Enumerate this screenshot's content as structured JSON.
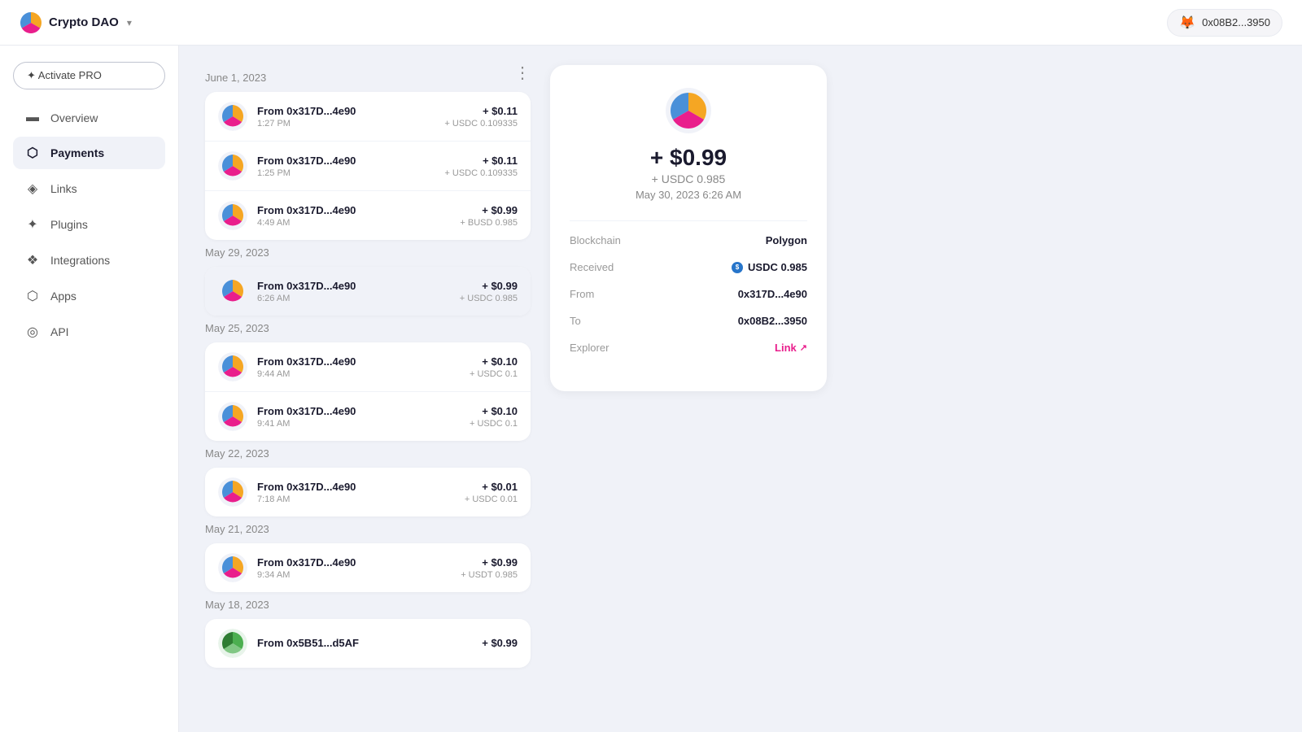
{
  "topbar": {
    "app_name": "Crypto DAO",
    "dropdown_label": "▾",
    "wallet_address": "0x08B2...3950",
    "fox_emoji": "🦊"
  },
  "sidebar": {
    "activate_btn": "✦ Activate PRO",
    "items": [
      {
        "id": "overview",
        "label": "Overview",
        "icon": "▬",
        "active": false
      },
      {
        "id": "payments",
        "label": "Payments",
        "icon": "⬡",
        "active": true
      },
      {
        "id": "links",
        "label": "Links",
        "icon": "◈",
        "active": false
      },
      {
        "id": "plugins",
        "label": "Plugins",
        "icon": "✦",
        "active": false
      },
      {
        "id": "integrations",
        "label": "Integrations",
        "icon": "❖",
        "active": false
      },
      {
        "id": "apps",
        "label": "Apps",
        "icon": "⬡",
        "active": false
      },
      {
        "id": "api",
        "label": "API",
        "icon": "◎",
        "active": false
      }
    ]
  },
  "payments": {
    "more_icon": "⋮",
    "groups": [
      {
        "date": "June 1, 2023",
        "items": [
          {
            "from": "From 0x317D...4e90",
            "time": "1:27 PM",
            "usd": "+ $0.11",
            "token": "+ USDC 0.109335",
            "selected": false
          },
          {
            "from": "From 0x317D...4e90",
            "time": "1:25 PM",
            "usd": "+ $0.11",
            "token": "+ USDC 0.109335",
            "selected": false
          },
          {
            "from": "From 0x317D...4e90",
            "time": "4:49 AM",
            "usd": "+ $0.99",
            "token": "+ BUSD 0.985",
            "selected": false
          }
        ]
      },
      {
        "date": "May 29, 2023",
        "items": [
          {
            "from": "From 0x317D...4e90",
            "time": "6:26 AM",
            "usd": "+ $0.99",
            "token": "+ USDC 0.985",
            "selected": true
          }
        ]
      },
      {
        "date": "May 25, 2023",
        "items": [
          {
            "from": "From 0x317D...4e90",
            "time": "9:44 AM",
            "usd": "+ $0.10",
            "token": "+ USDC 0.1",
            "selected": false
          },
          {
            "from": "From 0x317D...4e90",
            "time": "9:41 AM",
            "usd": "+ $0.10",
            "token": "+ USDC 0.1",
            "selected": false
          }
        ]
      },
      {
        "date": "May 22, 2023",
        "items": [
          {
            "from": "From 0x317D...4e90",
            "time": "7:18 AM",
            "usd": "+ $0.01",
            "token": "+ USDC 0.01",
            "selected": false
          }
        ]
      },
      {
        "date": "May 21, 2023",
        "items": [
          {
            "from": "From 0x317D...4e90",
            "time": "9:34 AM",
            "usd": "+ $0.99",
            "token": "+ USDT 0.985",
            "selected": false
          }
        ]
      },
      {
        "date": "May 18, 2023",
        "items": [
          {
            "from": "From 0x5B51...d5AF",
            "time": "",
            "usd": "+ $0.99",
            "token": "",
            "selected": false
          }
        ]
      }
    ]
  },
  "detail": {
    "amount": "+ $0.99",
    "token": "+ USDC 0.985",
    "date": "May 30, 2023 6:26 AM",
    "blockchain_label": "Blockchain",
    "blockchain_value": "Polygon",
    "received_label": "Received",
    "received_value": "USDC 0.985",
    "from_label": "From",
    "from_value": "0x317D...4e90",
    "to_label": "To",
    "to_value": "0x08B2...3950",
    "explorer_label": "Explorer",
    "explorer_link": "Link"
  }
}
